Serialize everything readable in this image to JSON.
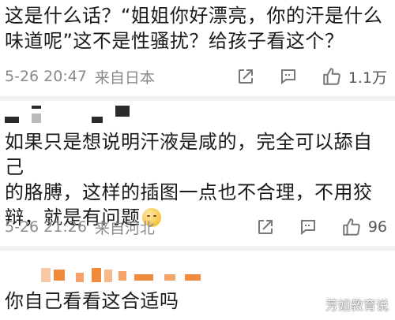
{
  "comments": [
    {
      "text": "这是什么话？“姐姐你好漂亮，你的汗是什么\n味道呢”这不是性骚扰？给孩子看这个？",
      "date": "5-26 20:47",
      "source": "来自日本",
      "likes": "1.1万"
    },
    {
      "text": "如果只是想说明汗液是咸的，完全可以舔自己\n的胳膊，这样的插图一点也不合理，不用狡\n辩，就是有问题",
      "date": "5-26 21:26",
      "source": "来自河北",
      "likes": "96"
    },
    {
      "text": "你自己看看这合适吗"
    }
  ],
  "icons": {
    "share": "share-icon",
    "comment": "comment-icon",
    "like": "thumbs-up-icon",
    "emoji": "smirk-emoji-icon"
  },
  "colors": {
    "meta_text": "#8a8a8a",
    "redaction_dark": "#2b2b2b",
    "redaction_orange": "#f08a3c",
    "divider": "#f2f2f2"
  },
  "watermark": "芳姐教育说"
}
